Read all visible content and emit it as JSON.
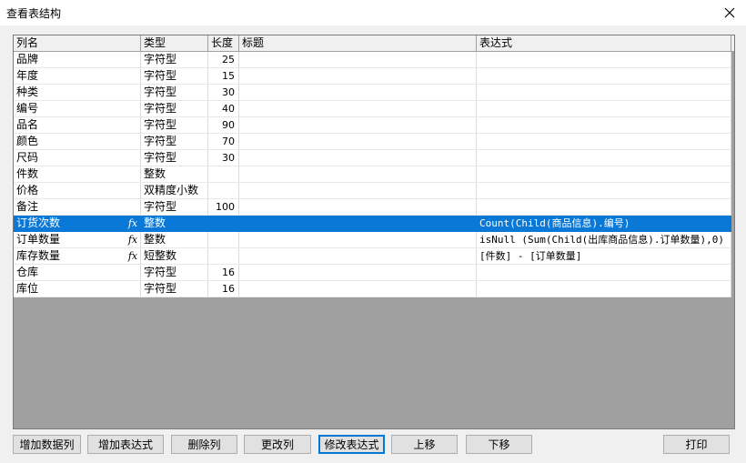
{
  "window": {
    "title": "查看表结构"
  },
  "columns": {
    "name": "列名",
    "type": "类型",
    "length": "长度",
    "title": "标题",
    "expression": "表达式"
  },
  "rows": [
    {
      "name": "品牌",
      "fx": "",
      "type": "字符型",
      "length": "25",
      "title": "",
      "expression": ""
    },
    {
      "name": "年度",
      "fx": "",
      "type": "字符型",
      "length": "15",
      "title": "",
      "expression": ""
    },
    {
      "name": "种类",
      "fx": "",
      "type": "字符型",
      "length": "30",
      "title": "",
      "expression": ""
    },
    {
      "name": "编号",
      "fx": "",
      "type": "字符型",
      "length": "40",
      "title": "",
      "expression": ""
    },
    {
      "name": "品名",
      "fx": "",
      "type": "字符型",
      "length": "90",
      "title": "",
      "expression": ""
    },
    {
      "name": "颜色",
      "fx": "",
      "type": "字符型",
      "length": "70",
      "title": "",
      "expression": ""
    },
    {
      "name": "尺码",
      "fx": "",
      "type": "字符型",
      "length": "30",
      "title": "",
      "expression": ""
    },
    {
      "name": "件数",
      "fx": "",
      "type": "整数",
      "length": "",
      "title": "",
      "expression": ""
    },
    {
      "name": "价格",
      "fx": "",
      "type": "双精度小数",
      "length": "",
      "title": "",
      "expression": ""
    },
    {
      "name": "备注",
      "fx": "",
      "type": "字符型",
      "length": "100",
      "title": "",
      "expression": ""
    },
    {
      "name": "订货次数",
      "fx": "fx",
      "type": "整数",
      "length": "",
      "title": "",
      "expression": "Count(Child(商品信息).编号)",
      "selected": true
    },
    {
      "name": "订单数量",
      "fx": "fx",
      "type": "整数",
      "length": "",
      "title": "",
      "expression": "isNull (Sum(Child(出库商品信息).订单数量),0)"
    },
    {
      "name": "库存数量",
      "fx": "fx",
      "type": "短整数",
      "length": "",
      "title": "",
      "expression": "[件数] - [订单数量]"
    },
    {
      "name": "仓库",
      "fx": "",
      "type": "字符型",
      "length": "16",
      "title": "",
      "expression": ""
    },
    {
      "name": "库位",
      "fx": "",
      "type": "字符型",
      "length": "16",
      "title": "",
      "expression": ""
    }
  ],
  "buttons": {
    "add_data_column": "增加数据列",
    "add_expression": "增加表达式",
    "delete_column": "删除列",
    "modify_column": "更改列",
    "modify_expression": "修改表达式",
    "move_up": "上移",
    "move_down": "下移",
    "print": "打印"
  },
  "colors": {
    "selection": "#0a78d7",
    "empty_area": "#a0a0a0",
    "focus_border": "#0078d7"
  }
}
